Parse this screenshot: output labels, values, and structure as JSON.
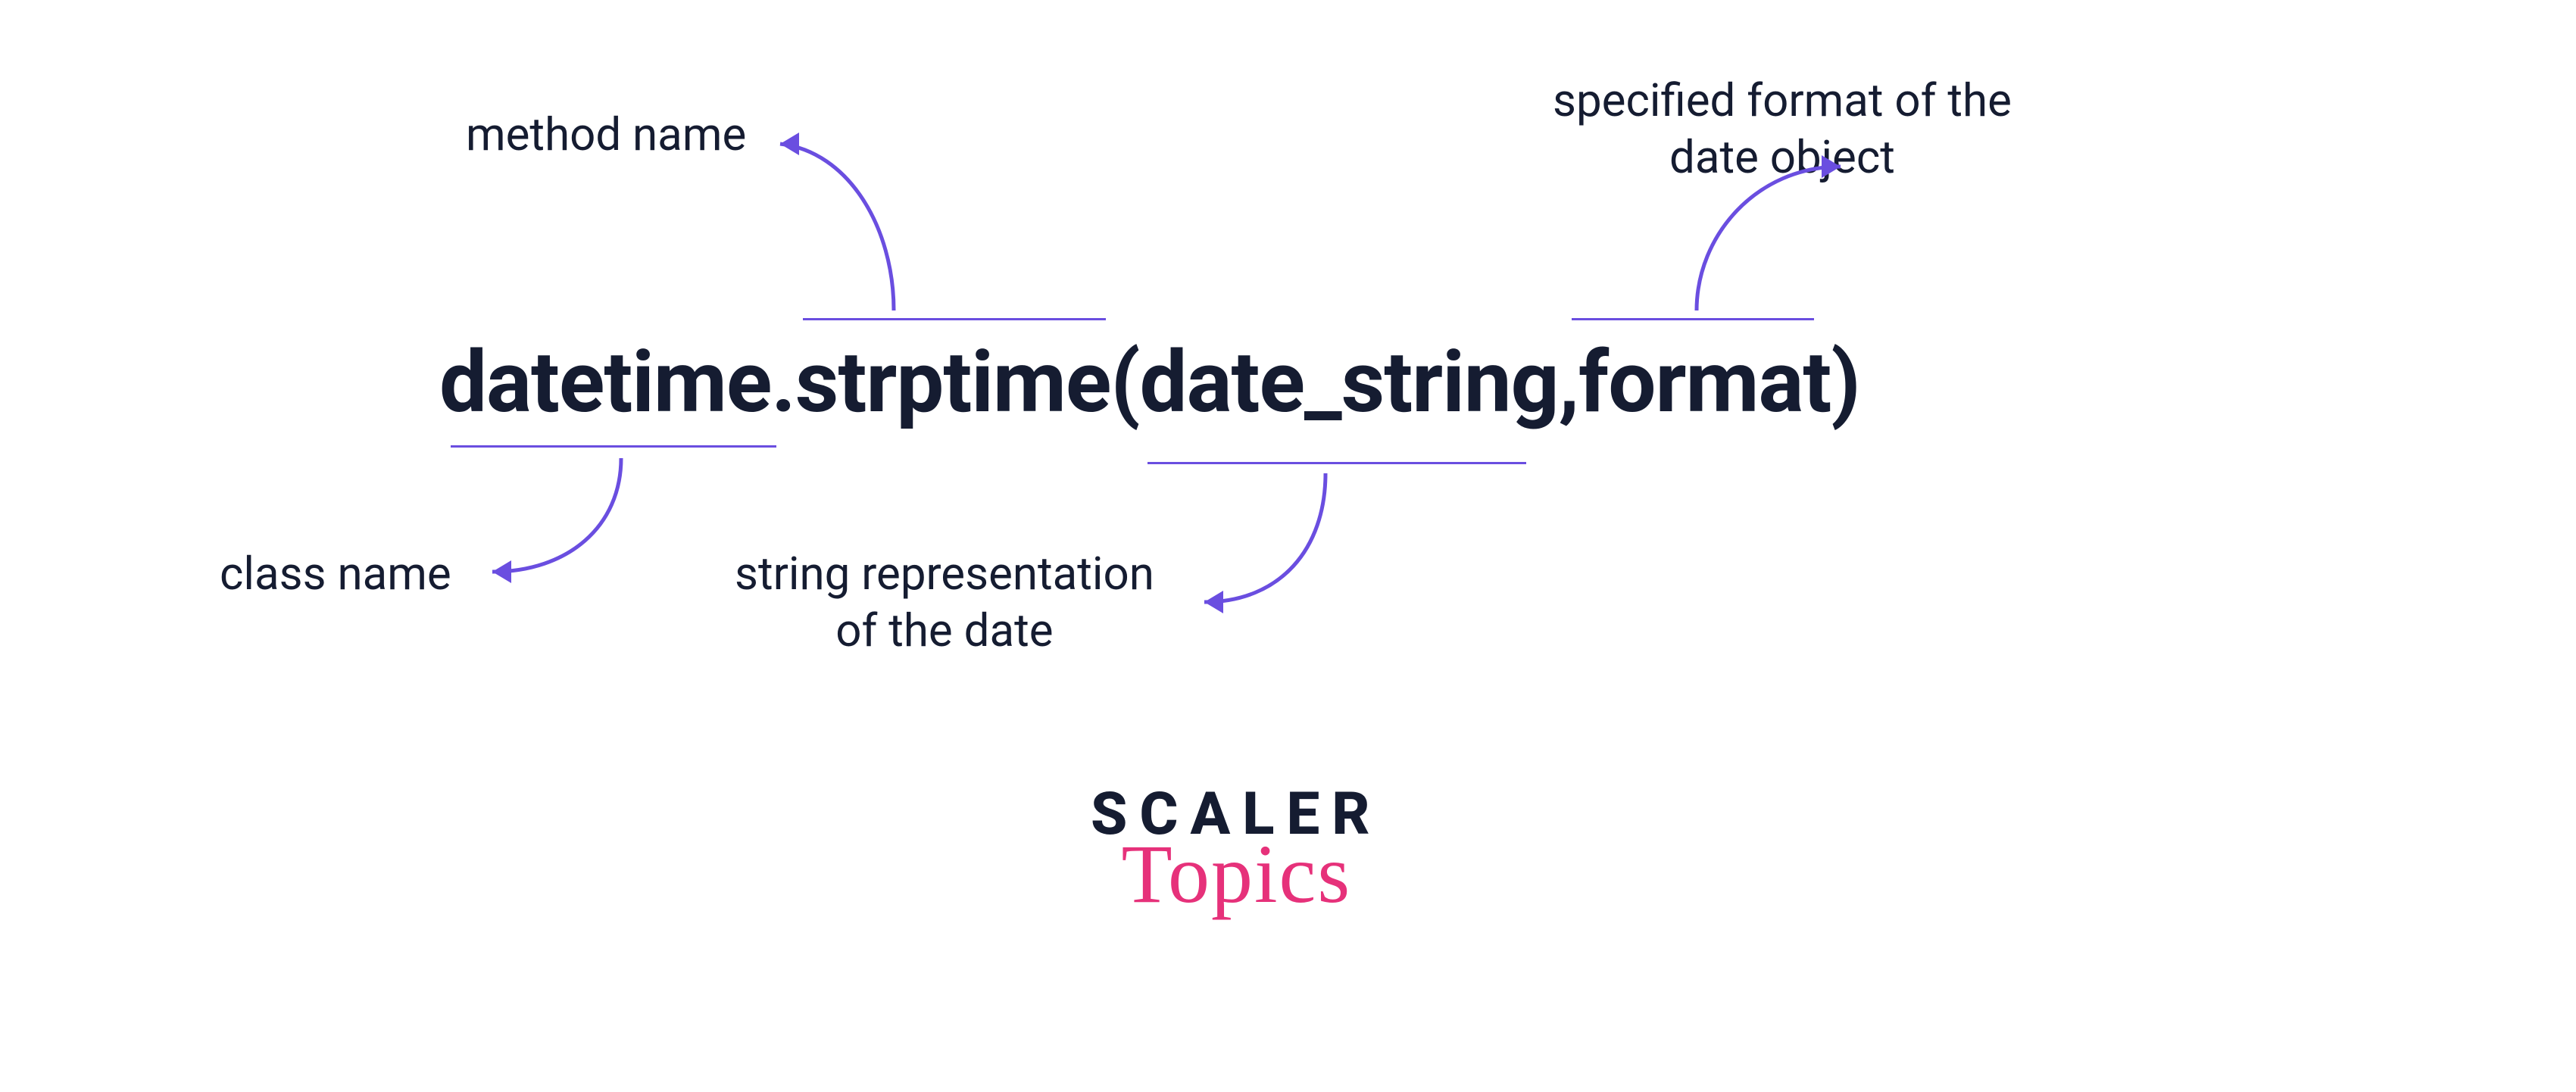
{
  "expression": {
    "part1": "datetime",
    "dot": ".",
    "part2": "strptime",
    "open": "(",
    "arg1": "date_string",
    "comma": ",",
    "space": " ",
    "arg2": "format",
    "close": ")"
  },
  "annotations": {
    "method_name": "method name",
    "class_name": "class name",
    "string_rep_l1": "string representation",
    "string_rep_l2": "of the date",
    "format_l1": "specified format of the",
    "format_l2": "date object"
  },
  "logo": {
    "top": "SCALER",
    "bottom": "Topics"
  },
  "colors": {
    "text": "#151c31",
    "accent": "#6a4ee0",
    "logo_pink": "#e6317a"
  }
}
